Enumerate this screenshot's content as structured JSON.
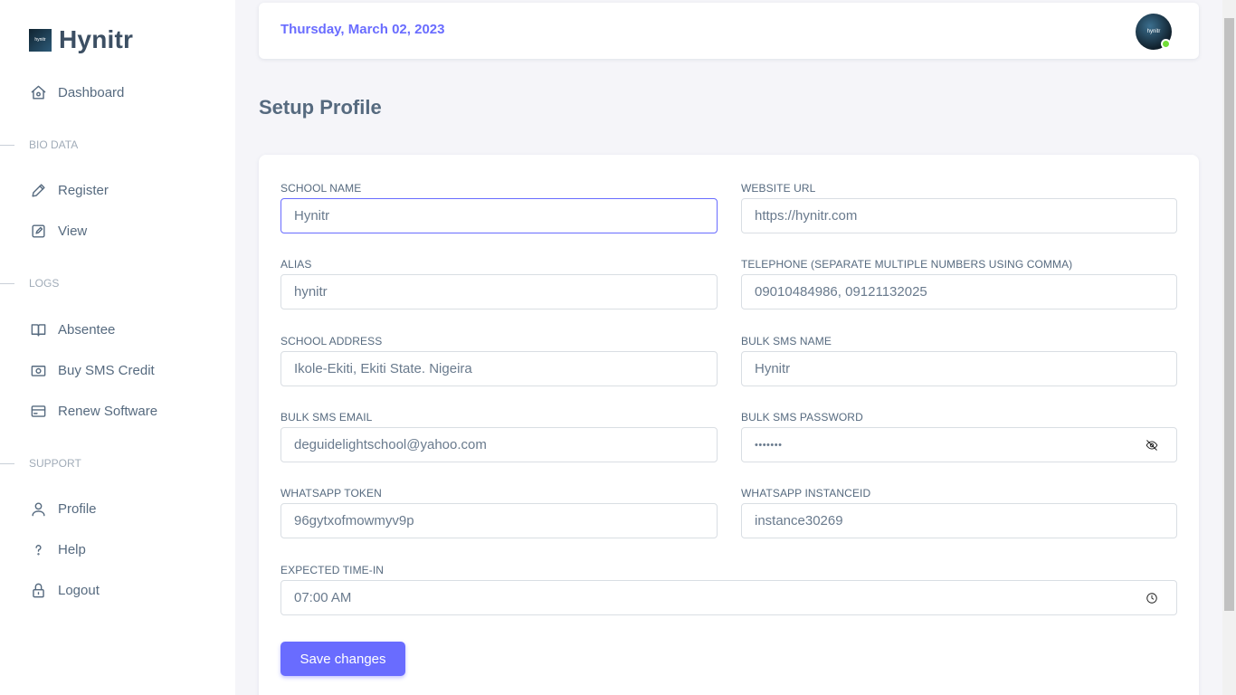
{
  "brand": {
    "logo_text": "hynitr",
    "name": "Hynitr"
  },
  "sidebar": {
    "dashboard": "Dashboard",
    "section_bio": "BIO DATA",
    "register": "Register",
    "view": "View",
    "section_logs": "LOGS",
    "absentee": "Absentee",
    "buy_sms": "Buy SMS Credit",
    "renew": "Renew Software",
    "section_support": "SUPPORT",
    "profile": "Profile",
    "help": "Help",
    "logout": "Logout"
  },
  "topbar": {
    "date": "Thursday, March 02, 2023",
    "avatar_text": "hynitr"
  },
  "page": {
    "title": "Setup Profile"
  },
  "form": {
    "school_name": {
      "label": "SCHOOL NAME",
      "value": "Hynitr"
    },
    "website_url": {
      "label": "WEBSITE URL",
      "value": "https://hynitr.com"
    },
    "alias": {
      "label": "ALIAS",
      "value": "hynitr"
    },
    "telephone": {
      "label": "TELEPHONE (SEPARATE MULTIPLE NUMBERS USING COMMA)",
      "value": "09010484986, 09121132025"
    },
    "school_address": {
      "label": "SCHOOL ADDRESS",
      "value": "Ikole-Ekiti, Ekiti State. Nigeira"
    },
    "bulk_sms_name": {
      "label": "BULK SMS NAME",
      "value": "Hynitr"
    },
    "bulk_sms_email": {
      "label": "BULK SMS EMAIL",
      "value": "deguidelightschool@yahoo.com"
    },
    "bulk_sms_password": {
      "label": "BULK SMS PASSWORD",
      "value": "•••••••"
    },
    "whatsapp_token": {
      "label": "WHATSAPP TOKEN",
      "value": "96gytxofmowmyv9p"
    },
    "whatsapp_instance": {
      "label": "WHATSAPP INSTANCEID",
      "value": "instance30269"
    },
    "expected_time": {
      "label": "EXPECTED TIME-IN",
      "value": "07:00 AM"
    },
    "save_label": "Save changes"
  },
  "icons": {
    "dashboard": "home-icon",
    "register": "pencil-icon",
    "view": "edit-square-icon",
    "absentee": "book-open-icon",
    "buy_sms": "money-icon",
    "renew": "credit-card-icon",
    "profile": "user-icon",
    "help": "question-icon",
    "logout": "lock-icon",
    "password_toggle": "eye-off-icon",
    "time": "clock-icon"
  },
  "colors": {
    "accent": "#696cff",
    "status_online": "#71dd37"
  }
}
